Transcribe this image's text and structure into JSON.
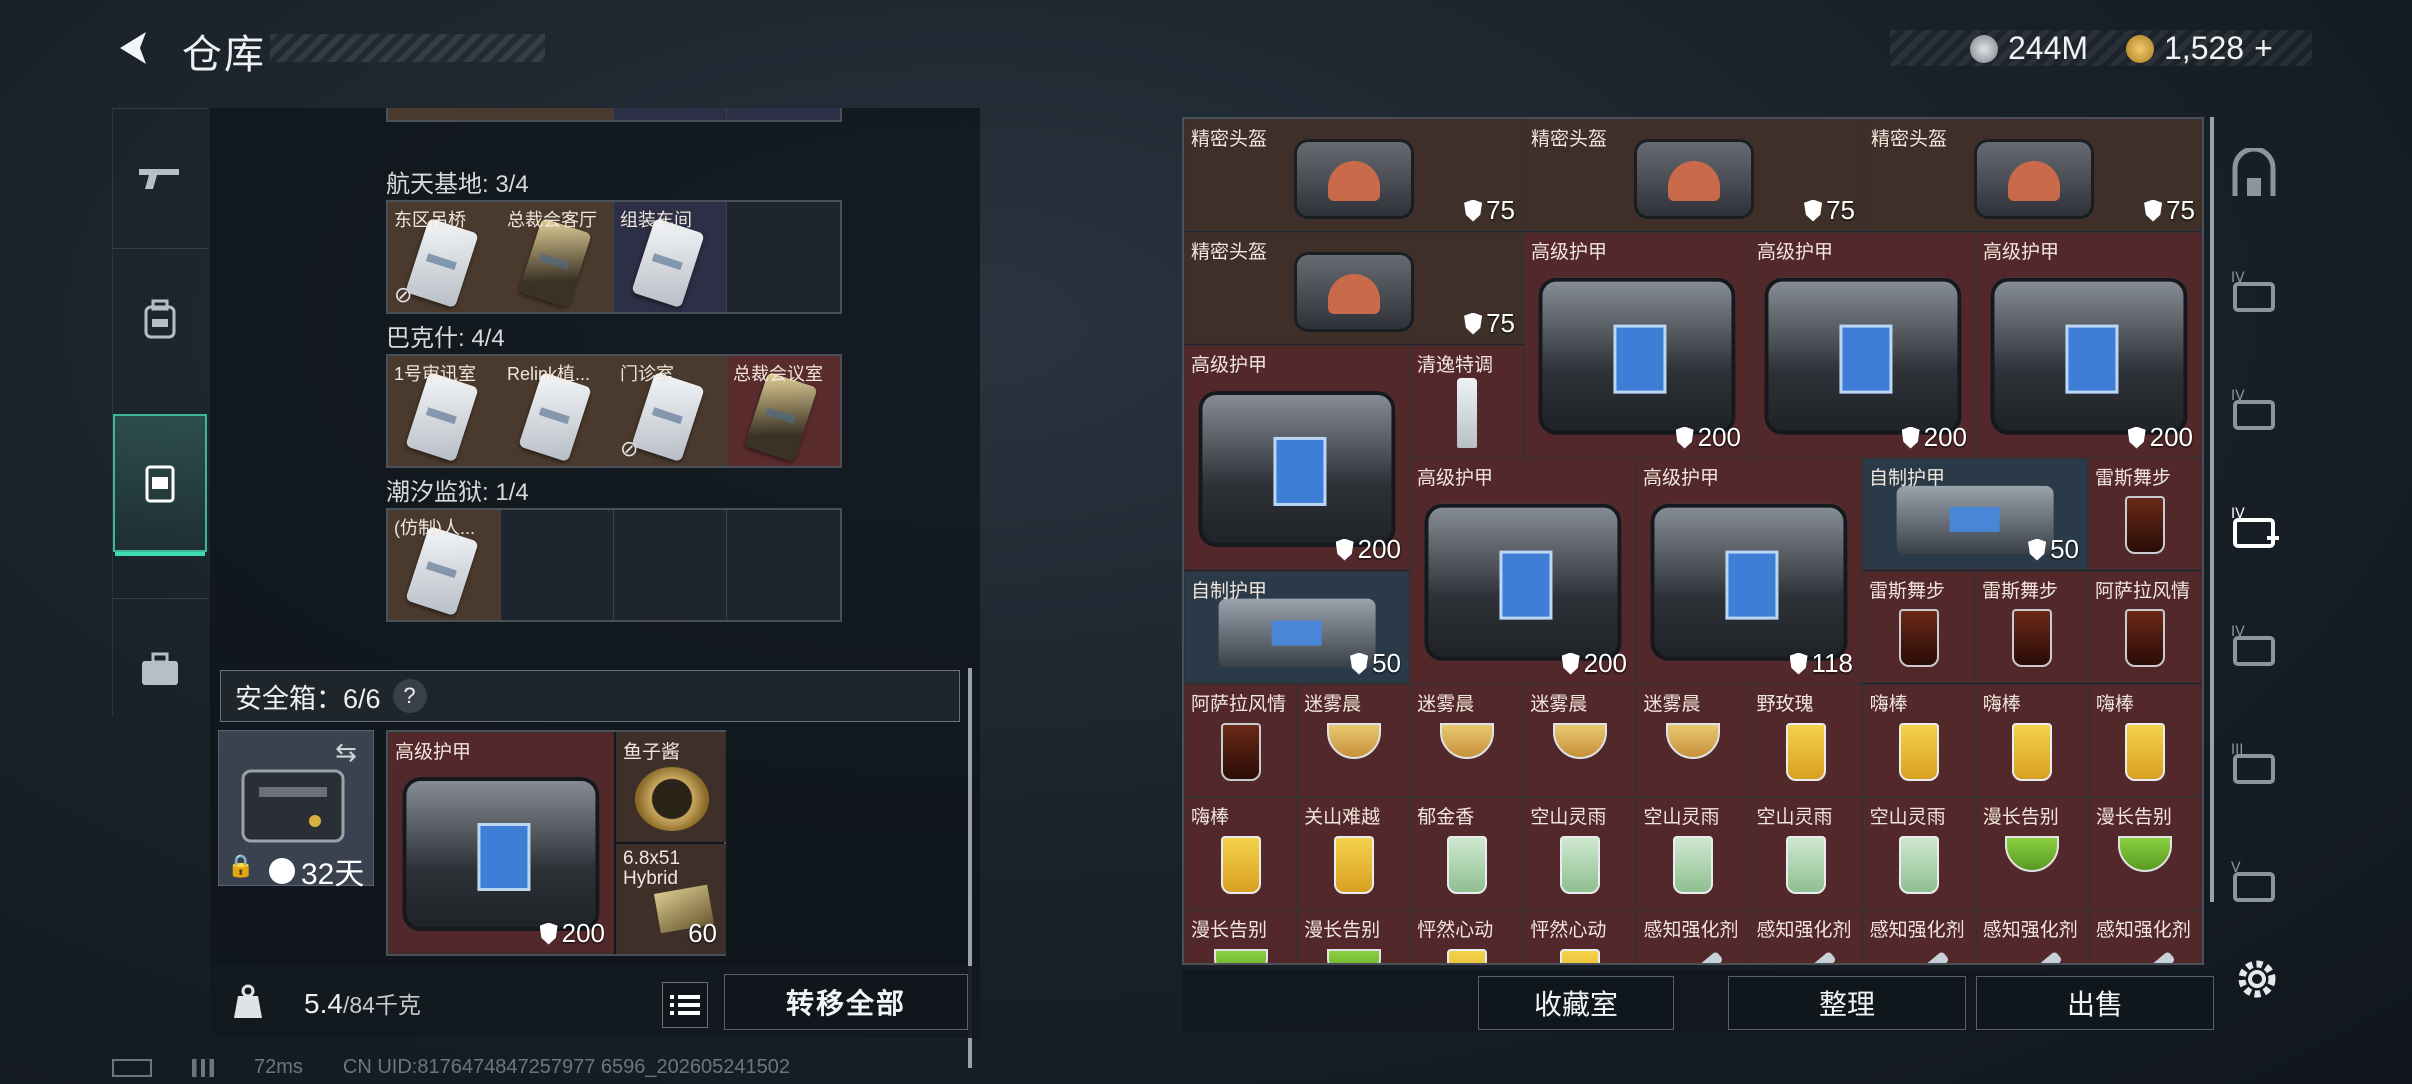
{
  "header": {
    "title": "仓库",
    "currency_1": "244M",
    "currency_2": "1,528",
    "currency_2_add": "+"
  },
  "left_nav": [
    {
      "icon": "gun-icon"
    },
    {
      "icon": "backpack-icon"
    },
    {
      "icon": "vest-icon",
      "active": true
    },
    {
      "icon": "briefcase-icon"
    }
  ],
  "keycard_sections": [
    {
      "label": "航天基地: 3/4",
      "cards": [
        {
          "name": "东区吊桥",
          "color": "gold",
          "nodrop": true
        },
        {
          "name": "总裁会客厅",
          "color": "gold",
          "gold": true
        },
        {
          "name": "组装车间",
          "color": "blue"
        },
        {
          "name": "",
          "color": "empty"
        }
      ]
    },
    {
      "label": "巴克什: 4/4",
      "cards": [
        {
          "name": "1号审讯室",
          "color": "gold"
        },
        {
          "name": "Relink植...",
          "color": "gold"
        },
        {
          "name": "门诊室",
          "color": "gold",
          "nodrop": true
        },
        {
          "name": "总裁会议室",
          "color": "red",
          "gold": true
        }
      ]
    },
    {
      "label": "潮汐监狱: 1/4",
      "cards": [
        {
          "name": "(仿制)人...",
          "color": "gold"
        },
        {
          "name": "",
          "color": "empty"
        },
        {
          "name": "",
          "color": "empty"
        },
        {
          "name": "",
          "color": "empty"
        }
      ]
    }
  ],
  "safe_box": {
    "label": "安全箱：6/6",
    "help": "?",
    "days": "32天",
    "items": [
      {
        "name": "高级护甲",
        "value": "200"
      },
      {
        "name": "鱼子酱",
        "value": ""
      },
      {
        "name": "6.8x51 Hybrid",
        "value": "60"
      }
    ]
  },
  "weight": {
    "current": "5.4",
    "max": "/84千克"
  },
  "buttons": {
    "transfer_all": "转移全部",
    "collection": "收藏室",
    "sort": "整理",
    "sell": "出售"
  },
  "stash_items": [
    {
      "name": "精密头盔",
      "value": "75",
      "type": "helmet"
    },
    {
      "name": "精密头盔",
      "value": "75",
      "type": "helmet"
    },
    {
      "name": "精密头盔",
      "value": "75",
      "type": "helmet"
    },
    {
      "name": "精密头盔",
      "value": "75",
      "type": "helmet"
    },
    {
      "name": "高级护甲",
      "value": "200",
      "type": "bigbag"
    },
    {
      "name": "高级护甲",
      "value": "200",
      "type": "bigbag"
    },
    {
      "name": "高级护甲",
      "value": "200",
      "type": "bigbag"
    },
    {
      "name": "高级护甲",
      "value": "200",
      "type": "bigbag"
    },
    {
      "name": "清逸特调",
      "value": "",
      "type": "clear"
    },
    {
      "name": "高级护甲",
      "value": "200",
      "type": "bigbag"
    },
    {
      "name": "高级护甲",
      "value": "118",
      "type": "bigbag"
    },
    {
      "name": "自制护甲",
      "value": "50",
      "type": "smallbag"
    },
    {
      "name": "雷斯舞步",
      "value": "",
      "type": "cola"
    },
    {
      "name": "自制护甲",
      "value": "50",
      "type": "smallbag"
    },
    {
      "name": "雷斯舞步",
      "value": "",
      "type": "cola"
    },
    {
      "name": "雷斯舞步",
      "value": "",
      "type": "cola"
    },
    {
      "name": "阿萨拉风情",
      "value": "",
      "type": "cola"
    },
    {
      "name": "阿萨拉风情",
      "value": "",
      "type": "cola"
    },
    {
      "name": "迷雾晨",
      "value": "",
      "type": "cocktail"
    },
    {
      "name": "迷雾晨",
      "value": "",
      "type": "cocktail"
    },
    {
      "name": "迷雾晨",
      "value": "",
      "type": "cocktail"
    },
    {
      "name": "迷雾晨",
      "value": "",
      "type": "cocktail"
    },
    {
      "name": "野玫瑰",
      "value": "",
      "type": "yellow"
    },
    {
      "name": "嗨棒",
      "value": "",
      "type": "yellow"
    },
    {
      "name": "嗨棒",
      "value": "",
      "type": "yellow"
    },
    {
      "name": "嗨棒",
      "value": "",
      "type": "yellow"
    },
    {
      "name": "嗨棒",
      "value": "",
      "type": "yellow"
    },
    {
      "name": "关山难越",
      "value": "",
      "type": "yellow"
    },
    {
      "name": "郁金香",
      "value": "",
      "type": "mojito"
    },
    {
      "name": "空山灵雨",
      "value": "",
      "type": "mojito"
    },
    {
      "name": "空山灵雨",
      "value": "",
      "type": "mojito"
    },
    {
      "name": "空山灵雨",
      "value": "",
      "type": "mojito"
    },
    {
      "name": "空山灵雨",
      "value": "",
      "type": "mojito"
    },
    {
      "name": "漫长告别",
      "value": "",
      "type": "green"
    },
    {
      "name": "漫长告别",
      "value": "",
      "type": "green"
    },
    {
      "name": "漫长告别",
      "value": "",
      "type": "green"
    },
    {
      "name": "漫长告别",
      "value": "",
      "type": "green"
    },
    {
      "name": "怦然心动",
      "value": "",
      "type": "yellow"
    },
    {
      "name": "怦然心动",
      "value": "",
      "type": "yellow"
    },
    {
      "name": "感知强化剂",
      "value": "",
      "type": "syringe"
    },
    {
      "name": "感知强化剂",
      "value": "",
      "type": "syringe"
    },
    {
      "name": "感知强化剂",
      "value": "",
      "type": "syringe"
    },
    {
      "name": "感知强化剂",
      "value": "",
      "type": "syringe"
    },
    {
      "name": "感知强化剂",
      "value": "",
      "type": "syringe"
    }
  ],
  "right_nav": [
    {
      "icon": "safe-house-icon",
      "label": ""
    },
    {
      "icon": "tier-4-container-icon",
      "label": "IV"
    },
    {
      "icon": "tier-4-warning-icon",
      "label": "IV"
    },
    {
      "icon": "tier-4-add-icon",
      "label": "IV",
      "active": true
    },
    {
      "icon": "tier-4-add-dim-icon",
      "label": "IV"
    },
    {
      "icon": "tier-3-container-icon",
      "label": "III"
    },
    {
      "icon": "tier-5-container-icon",
      "label": "V"
    }
  ],
  "footer": {
    "ping": "72ms",
    "uid": "CN UID:8176474847257977 6596_202605241502"
  },
  "colors": {
    "accent": "#3fdcb2",
    "cell_red": "#53282a",
    "cell_brown": "#3e3028",
    "cell_blue": "#2a3a48"
  }
}
